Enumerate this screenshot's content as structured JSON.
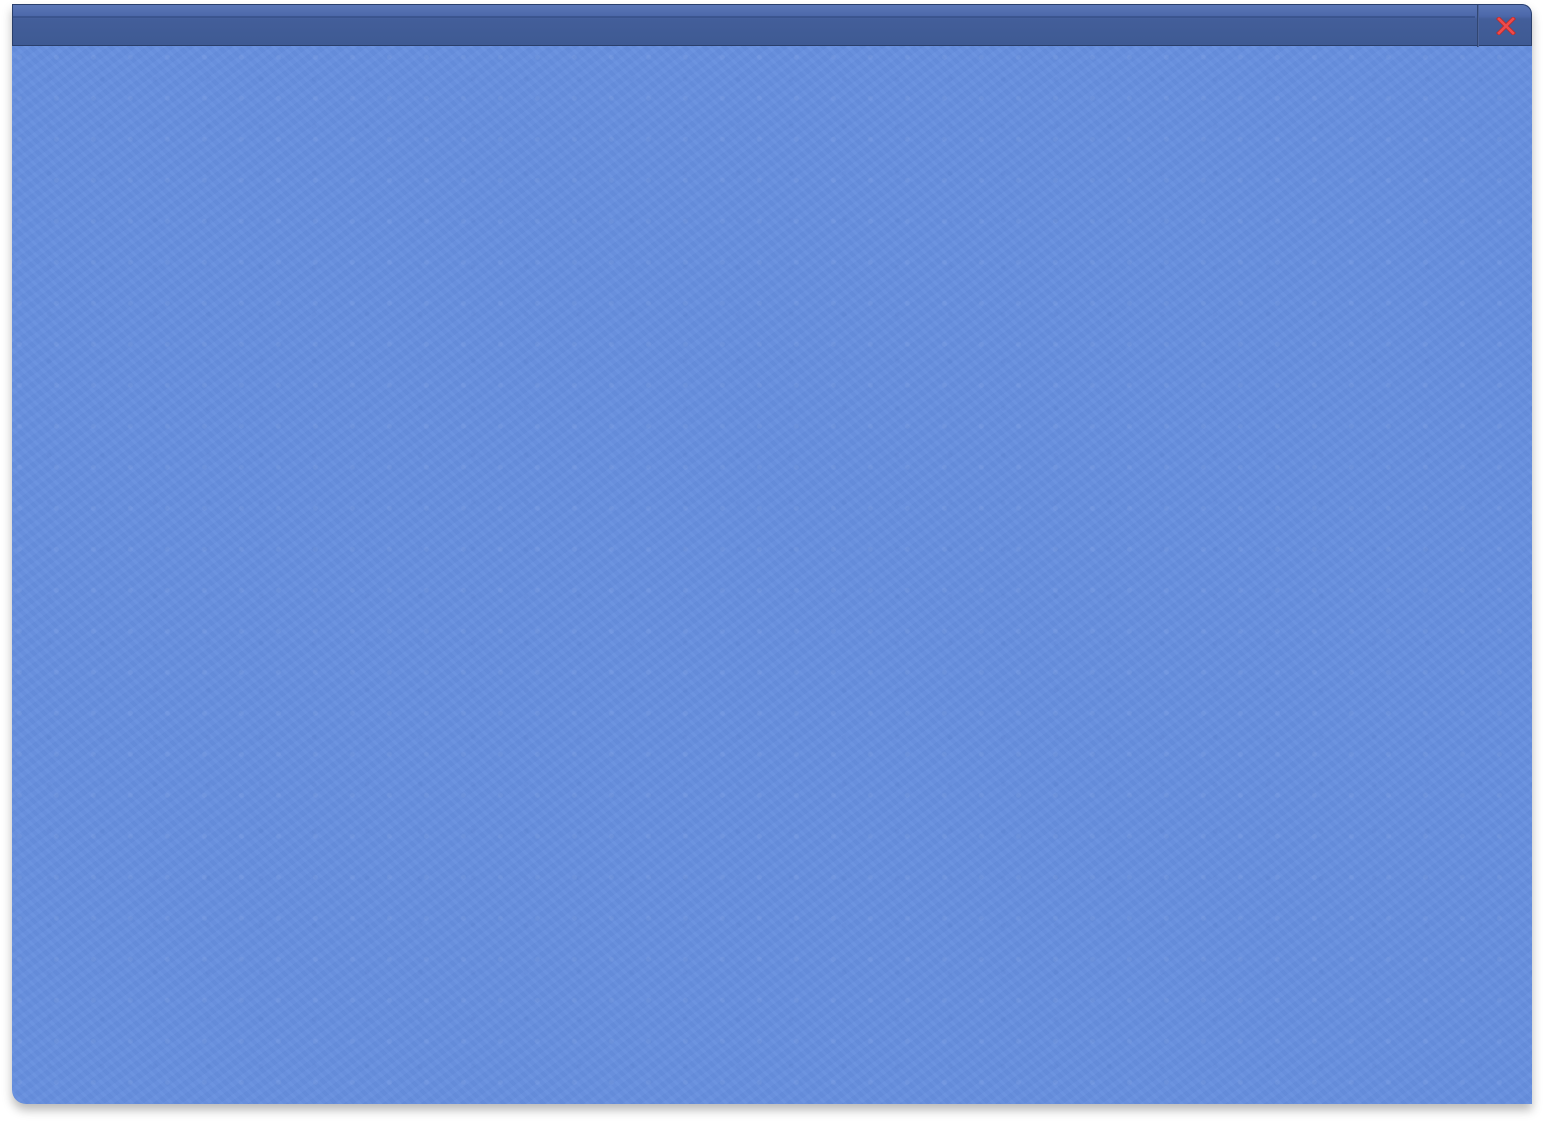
{
  "window": {
    "title": "",
    "background_color": "#668fdf",
    "titlebar_color": "#3e5a93",
    "close_icon_color": "#e0403f"
  },
  "titlebar": {
    "close_button": {
      "label": "",
      "icon": "close-icon"
    }
  }
}
